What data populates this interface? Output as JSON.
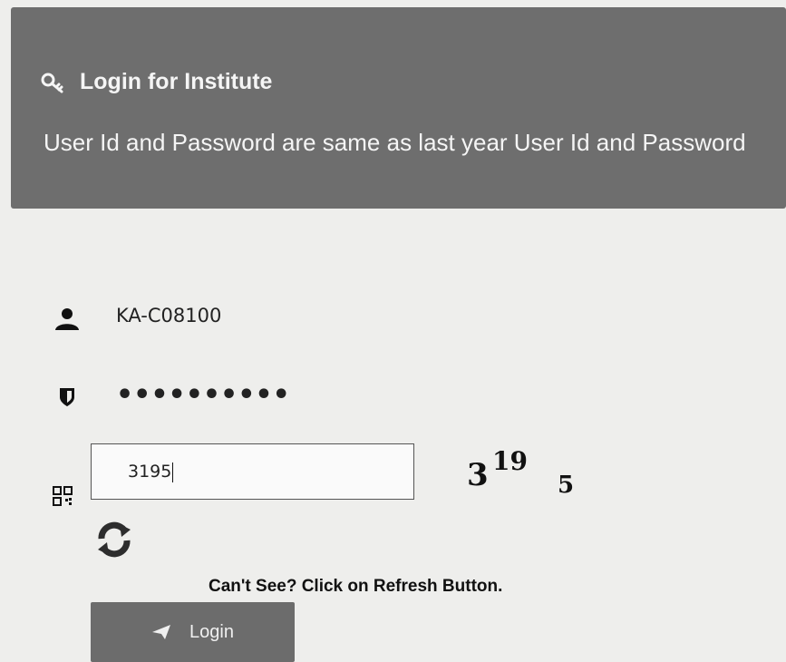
{
  "header": {
    "icon": "key-icon",
    "title": "Login for Institute",
    "notice": "User Id and Password are same as last year User Id and Password"
  },
  "form": {
    "user_id": {
      "icon": "user-icon",
      "value": "KA-C08100"
    },
    "password": {
      "icon": "shield-icon",
      "value": "••••••••••"
    },
    "captcha": {
      "icon": "qr-icon",
      "input_value": "3195",
      "image_glyphs": [
        "3",
        "19",
        "5"
      ]
    },
    "refresh": {
      "icon": "refresh-icon",
      "hint": "Can't See? Click on Refresh Button."
    },
    "login_button": {
      "icon": "send-icon",
      "label": "Login"
    }
  },
  "colors": {
    "panel": "#6e6e6e",
    "button": "#6c6c6c",
    "background": "#eeeeec"
  }
}
